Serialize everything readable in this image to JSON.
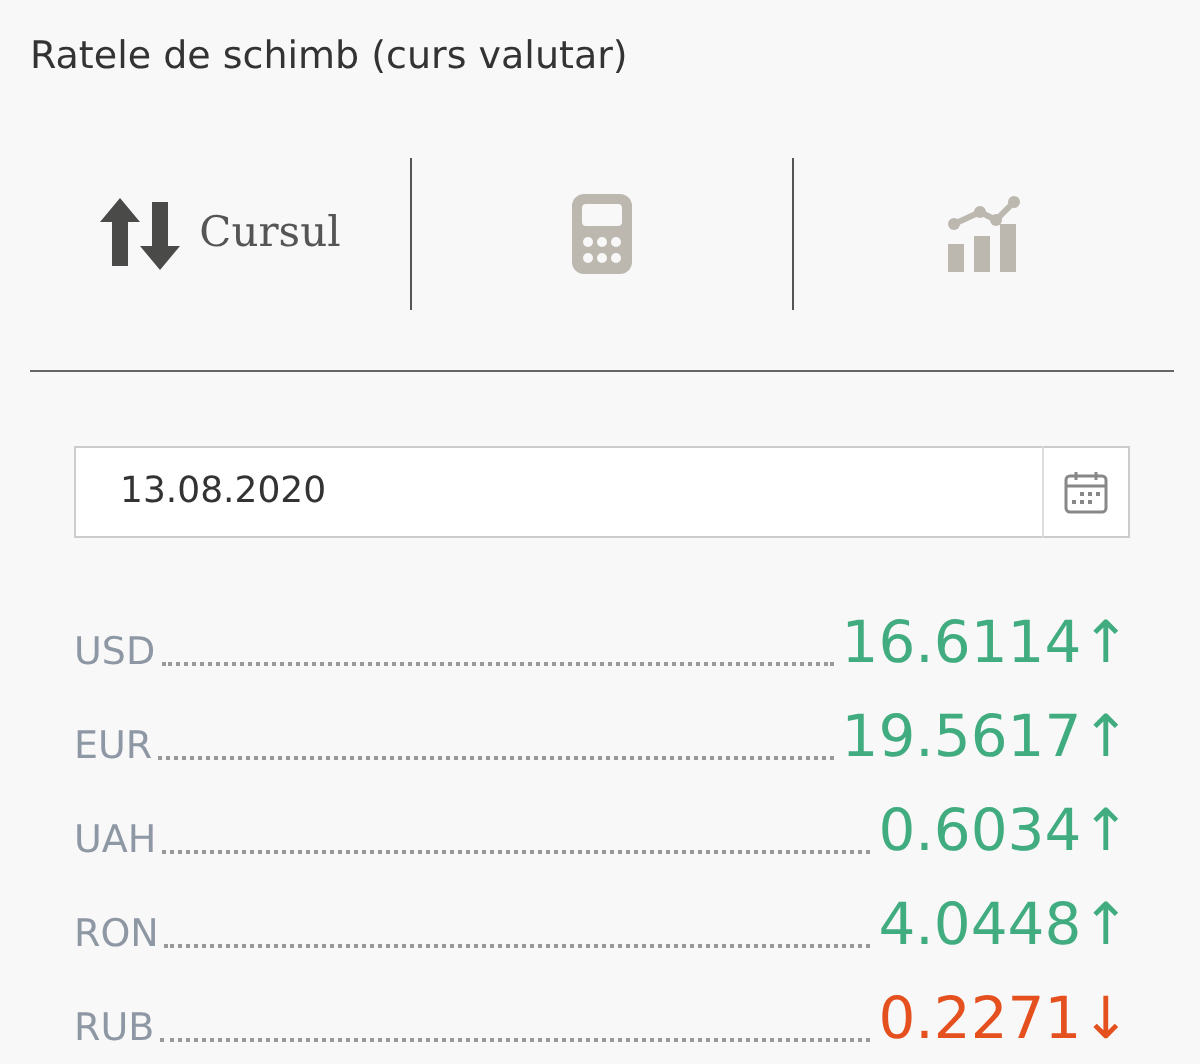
{
  "title": "Ratele de schimb (curs valutar)",
  "tabs": [
    {
      "kind": "rates",
      "label": "Cursul",
      "selected": true
    },
    {
      "kind": "calculator",
      "selected": false
    },
    {
      "kind": "chart",
      "selected": false
    }
  ],
  "date_field": {
    "value": "13.08.2020"
  },
  "rates": [
    {
      "currency": "USD",
      "value": "16.6114",
      "arrow": "↑",
      "color": "#41ac7f"
    },
    {
      "currency": "EUR",
      "value": "19.5617",
      "arrow": "↑",
      "color": "#41ac7f"
    },
    {
      "currency": "UAH",
      "value": "0.6034",
      "arrow": "↑",
      "color": "#41ac7f"
    },
    {
      "currency": "RON",
      "value": "4.0448",
      "arrow": "↑",
      "color": "#41ac7f"
    },
    {
      "currency": "RUB",
      "value": "0.2271",
      "arrow": "↓",
      "color": "#e5501f"
    }
  ]
}
